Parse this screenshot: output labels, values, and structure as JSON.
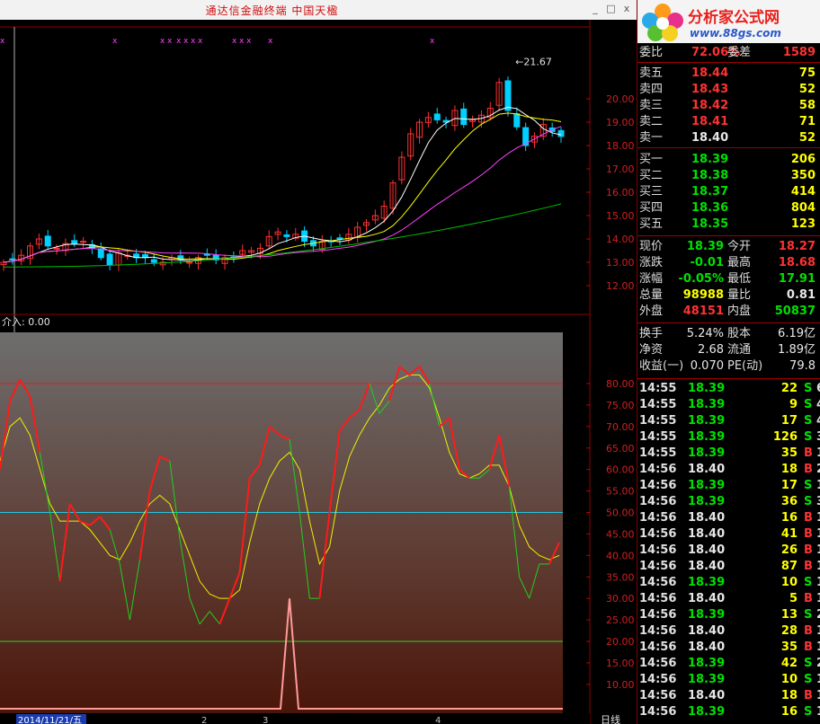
{
  "window": {
    "title": "通达信金融终端    中国天楹",
    "controls": [
      "_",
      "□",
      "x"
    ]
  },
  "logo": {
    "brand": "分析家公式网",
    "url": "www.88gs.com"
  },
  "price_axis": {
    "labels": [
      "21.67",
      "20.00",
      "19.00",
      "18.00",
      "17.00",
      "16.00",
      "15.00",
      "14.00",
      "13.00",
      "12.00"
    ]
  },
  "osc_axis": {
    "labels": [
      "80.00",
      "75.00",
      "70.00",
      "65.00",
      "60.00",
      "55.00",
      "50.00",
      "45.00",
      "40.00",
      "35.00",
      "30.00",
      "25.00",
      "20.00",
      "15.00",
      "10.00"
    ]
  },
  "indicator_label": "介入: 0.00",
  "bottom_bar": {
    "date": "2014/11/21/五",
    "marks": [
      "2",
      "3",
      "4"
    ],
    "period": "日线"
  },
  "quote": {
    "ratio": {
      "label": "委比",
      "value": "72.06%",
      "label2": "委差",
      "value2": "1589"
    },
    "asks": [
      {
        "label": "卖五",
        "price": "18.44",
        "vol": "75"
      },
      {
        "label": "卖四",
        "price": "18.43",
        "vol": "52"
      },
      {
        "label": "卖三",
        "price": "18.42",
        "vol": "58"
      },
      {
        "label": "卖二",
        "price": "18.41",
        "vol": "71"
      },
      {
        "label": "卖一",
        "price": "18.40",
        "vol": "52"
      }
    ],
    "bids": [
      {
        "label": "买一",
        "price": "18.39",
        "vol": "206"
      },
      {
        "label": "买二",
        "price": "18.38",
        "vol": "350"
      },
      {
        "label": "买三",
        "price": "18.37",
        "vol": "414"
      },
      {
        "label": "买四",
        "price": "18.36",
        "vol": "804"
      },
      {
        "label": "买五",
        "price": "18.35",
        "vol": "123"
      }
    ],
    "stats": [
      {
        "l1": "现价",
        "v1": "18.39",
        "l2": "今开",
        "v2": "18.27"
      },
      {
        "l1": "涨跌",
        "v1": "-0.01",
        "l2": "最高",
        "v2": "18.68"
      },
      {
        "l1": "涨幅",
        "v1": "-0.05%",
        "l2": "最低",
        "v2": "17.91"
      },
      {
        "l1": "总量",
        "v1": "98988",
        "l2": "量比",
        "v2": "0.81"
      },
      {
        "l1": "外盘",
        "v1": "48151",
        "l2": "内盘",
        "v2": "50837"
      }
    ],
    "extra": [
      {
        "l1": "换手",
        "v1": "5.24%",
        "l2": "股本",
        "v2": "6.19亿"
      },
      {
        "l1": "净资",
        "v1": "2.68",
        "l2": "流通",
        "v2": "1.89亿"
      },
      {
        "l1": "收益(一)",
        "v1": "0.070",
        "l2": "PE(动)",
        "v2": "79.8"
      }
    ]
  },
  "ticks": [
    {
      "t": "14:55",
      "p": "18.39",
      "v": "22",
      "d": "S",
      "n": "6"
    },
    {
      "t": "14:55",
      "p": "18.39",
      "v": "9",
      "d": "S",
      "n": "4"
    },
    {
      "t": "14:55",
      "p": "18.39",
      "v": "17",
      "d": "S",
      "n": "4"
    },
    {
      "t": "14:55",
      "p": "18.39",
      "v": "126",
      "d": "S",
      "n": "3"
    },
    {
      "t": "14:55",
      "p": "18.39",
      "v": "35",
      "d": "B",
      "n": "1"
    },
    {
      "t": "14:56",
      "p": "18.40",
      "v": "18",
      "d": "B",
      "n": "2"
    },
    {
      "t": "14:56",
      "p": "18.39",
      "v": "17",
      "d": "S",
      "n": "1"
    },
    {
      "t": "14:56",
      "p": "18.39",
      "v": "36",
      "d": "S",
      "n": "3"
    },
    {
      "t": "14:56",
      "p": "18.40",
      "v": "16",
      "d": "B",
      "n": "1"
    },
    {
      "t": "14:56",
      "p": "18.40",
      "v": "41",
      "d": "B",
      "n": "1"
    },
    {
      "t": "14:56",
      "p": "18.40",
      "v": "26",
      "d": "B",
      "n": "1"
    },
    {
      "t": "14:56",
      "p": "18.40",
      "v": "87",
      "d": "B",
      "n": "1"
    },
    {
      "t": "14:56",
      "p": "18.39",
      "v": "10",
      "d": "S",
      "n": "1"
    },
    {
      "t": "14:56",
      "p": "18.40",
      "v": "5",
      "d": "B",
      "n": "1"
    },
    {
      "t": "14:56",
      "p": "18.39",
      "v": "13",
      "d": "S",
      "n": "2"
    },
    {
      "t": "14:56",
      "p": "18.40",
      "v": "28",
      "d": "B",
      "n": "1"
    },
    {
      "t": "14:56",
      "p": "18.40",
      "v": "35",
      "d": "B",
      "n": "1"
    },
    {
      "t": "14:56",
      "p": "18.39",
      "v": "42",
      "d": "S",
      "n": "2"
    },
    {
      "t": "14:56",
      "p": "18.39",
      "v": "10",
      "d": "S",
      "n": "1"
    },
    {
      "t": "14:56",
      "p": "18.40",
      "v": "18",
      "d": "B",
      "n": "1"
    },
    {
      "t": "14:56",
      "p": "18.39",
      "v": "16",
      "d": "S",
      "n": "1"
    }
  ],
  "colors": {
    "up": "#ff3232",
    "down": "#00e000",
    "kline_up": "#ff3030",
    "kline_down": "#00d0ff",
    "ma5": "#ffffff",
    "ma10": "#ffff00",
    "ma20": "#ff40ff",
    "ma60": "#00c000"
  },
  "chart_data": {
    "type": "line",
    "price_panel": {
      "ylim": [
        12.0,
        21.67
      ],
      "closes": [
        13.0,
        13.1,
        13.3,
        13.7,
        14.0,
        13.7,
        13.6,
        13.8,
        13.8,
        13.9,
        13.6,
        13.2,
        12.9,
        13.4,
        13.3,
        13.2,
        13.2,
        13.0,
        13.0,
        13.2,
        13.1,
        13.0,
        13.2,
        13.3,
        13.1,
        13.2,
        13.2,
        13.5,
        13.5,
        13.6,
        14.1,
        14.3,
        14.1,
        14.2,
        13.9,
        13.7,
        13.9,
        13.9,
        14.0,
        14.2,
        14.5,
        14.7,
        15.0,
        15.4,
        16.4,
        17.5,
        18.5,
        19.0,
        19.2,
        19.1,
        19.0,
        19.5,
        18.9,
        19.1,
        19.3,
        19.6,
        20.7,
        19.5,
        18.8,
        18.0,
        18.4,
        18.9,
        18.6,
        18.39
      ],
      "max_label": "21.67",
      "ma60_range": [
        12.8,
        15.5
      ]
    },
    "oscillator_panel": {
      "ylim": [
        0,
        85
      ],
      "ref_lines": [
        80,
        50,
        20
      ],
      "fast": [
        60,
        76,
        81,
        77,
        64,
        50,
        34,
        52,
        48,
        47,
        49,
        46,
        38,
        25,
        39,
        55,
        63,
        62,
        44,
        30,
        24,
        27,
        24,
        30,
        36,
        58,
        61,
        70,
        68,
        67,
        50,
        30,
        30,
        50,
        69,
        72,
        74,
        80,
        73,
        76,
        84,
        82,
        84,
        80,
        70,
        72,
        60,
        58,
        58,
        60,
        68,
        56,
        35,
        30,
        38,
        38,
        43
      ],
      "slow": [
        62,
        70,
        72,
        68,
        60,
        52,
        48,
        48,
        48,
        46,
        43,
        40,
        39,
        43,
        48,
        52,
        54,
        52,
        46,
        40,
        34,
        31,
        30,
        30,
        32,
        43,
        52,
        58,
        62,
        64,
        60,
        48,
        38,
        42,
        55,
        63,
        68,
        72,
        75,
        79,
        81,
        82,
        82,
        79,
        72,
        64,
        59,
        58,
        59,
        61,
        61,
        56,
        47,
        42,
        40,
        39,
        40
      ],
      "spike": {
        "index": 28,
        "value": 30
      }
    }
  }
}
